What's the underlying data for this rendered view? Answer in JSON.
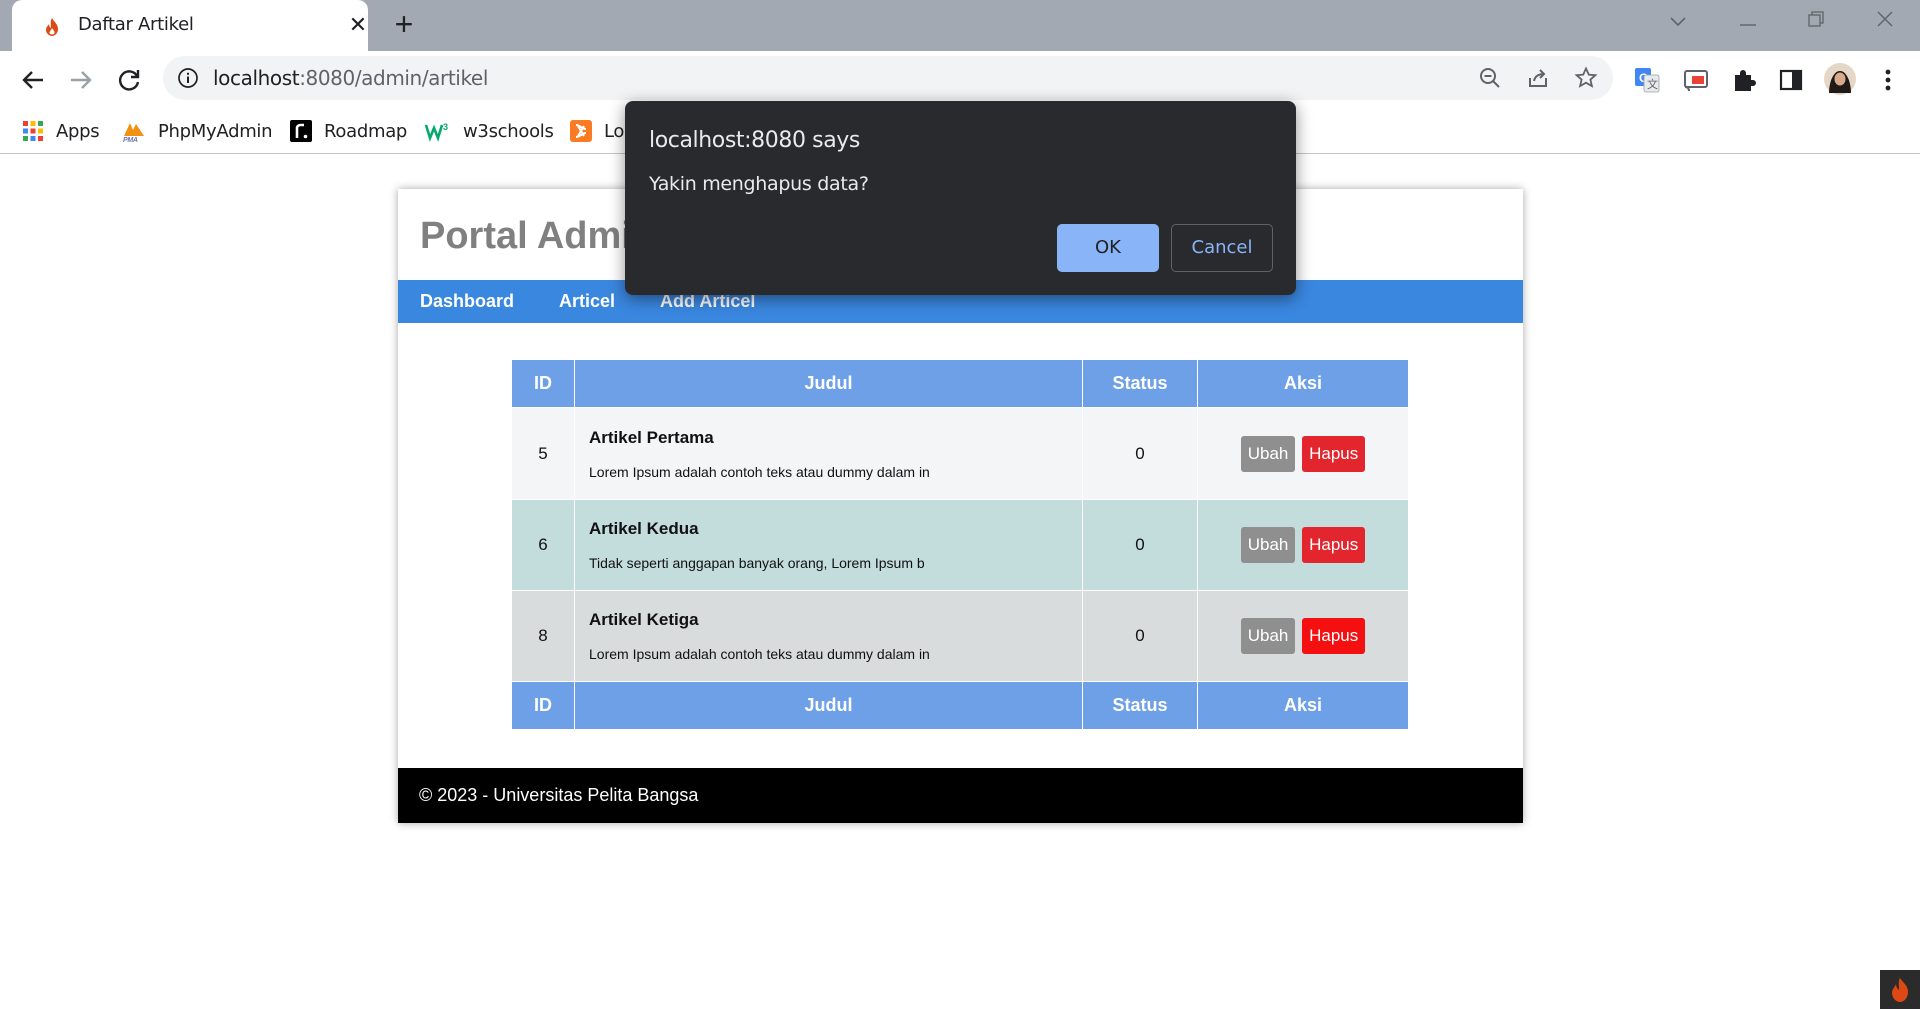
{
  "browser": {
    "tab_title": "Daftar Artikel",
    "url_host": "localhost",
    "url_rest": ":8080/admin/artikel",
    "bookmarks": [
      {
        "label": "Apps",
        "icon": "apps-grid-icon"
      },
      {
        "label": "PhpMyAdmin",
        "icon": "phpmyadmin-icon"
      },
      {
        "label": "Roadmap",
        "icon": "roadmap-icon"
      },
      {
        "label": "w3schools",
        "icon": "w3schools-icon"
      },
      {
        "label": "Lo",
        "icon": "xampp-icon"
      }
    ]
  },
  "site": {
    "title": "Portal Admin",
    "nav": [
      "Dashboard",
      "Articel",
      "Add Articel"
    ]
  },
  "table": {
    "headers": [
      "ID",
      "Judul",
      "Status",
      "Aksi"
    ],
    "rows": [
      {
        "id": "5",
        "title": "Artikel Pertama",
        "excerpt": "Lorem Ipsum adalah contoh teks atau dummy dalam in",
        "status": "0"
      },
      {
        "id": "6",
        "title": "Artikel Kedua",
        "excerpt": "Tidak seperti anggapan banyak orang, Lorem Ipsum b",
        "status": "0"
      },
      {
        "id": "8",
        "title": "Artikel Ketiga",
        "excerpt": "Lorem Ipsum adalah contoh teks atau dummy dalam in",
        "status": "0"
      }
    ],
    "edit_label": "Ubah",
    "delete_label": "Hapus"
  },
  "footer": {
    "text": "© 2023 - Universitas Pelita Bangsa"
  },
  "dialog": {
    "title": "localhost:8080 says",
    "message": "Yakin menghapus data?",
    "ok_label": "OK",
    "cancel_label": "Cancel"
  },
  "colors": {
    "navbar": "#3a87e0",
    "table_header": "#6da0e6",
    "delete_button": "#e3262e",
    "dialog_bg": "#292a2d",
    "dialog_ok": "#8ab4f8"
  }
}
